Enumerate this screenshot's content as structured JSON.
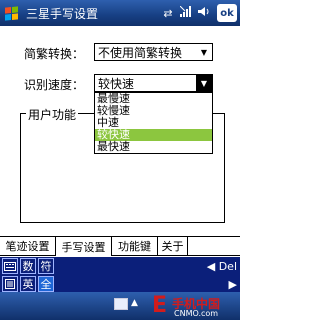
{
  "title_bar": {
    "app_title": "三星手写设置",
    "ok_label": "ok",
    "icons": [
      "windows-start-icon",
      "connectivity-icon",
      "signal-icon",
      "volume-icon"
    ]
  },
  "form": {
    "conversion_label": "简繁转换：",
    "conversion_value": "不使用简繁转换",
    "speed_label": "识别速度：",
    "speed_value": "较快速",
    "speed_options": [
      "最慢速",
      "较慢速",
      "中速",
      "较快速",
      "最快速"
    ],
    "speed_selected_index": 3,
    "group_title": "用户功能"
  },
  "tabs": [
    {
      "label": "笔迹设置",
      "active": false
    },
    {
      "label": "手写设置",
      "active": true
    },
    {
      "label": "功能键",
      "active": false
    },
    {
      "label": "关于",
      "active": false
    }
  ],
  "ime": {
    "row1": {
      "keys": [
        "数",
        "符"
      ],
      "right": "◀ Del"
    },
    "row2": {
      "keys": [
        "英",
        "全"
      ],
      "right": "▶"
    }
  },
  "watermark": {
    "cn": "手机中国",
    "en": "CNMO.com"
  },
  "colors": {
    "titlebar": "#173f83",
    "selection": "#8cc63f",
    "ime_bg": "#0b1f7a"
  }
}
